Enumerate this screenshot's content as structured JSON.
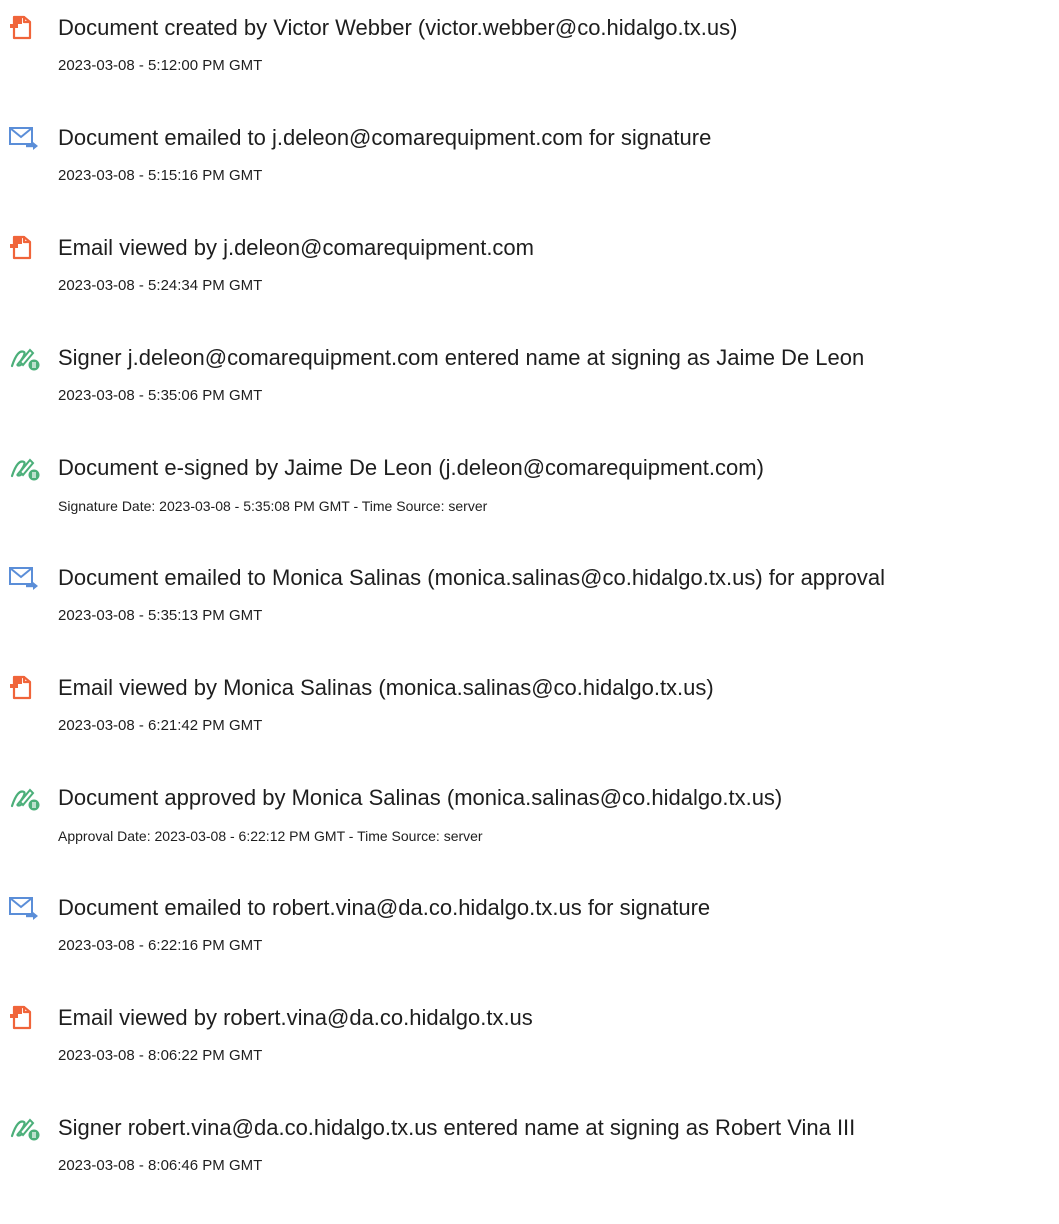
{
  "colors": {
    "doc_icon": "#f0643a",
    "email_icon": "#5b8ed8",
    "sign_icon": "#4caf7a"
  },
  "events": [
    {
      "icon": "document-icon",
      "title": "Document created by Victor Webber (victor.webber@co.hidalgo.tx.us)",
      "meta": "2023-03-08 - 5:12:00 PM GMT"
    },
    {
      "icon": "email-sent-icon",
      "title": "Document emailed to j.deleon@comarequipment.com for signature",
      "meta": "2023-03-08 - 5:15:16 PM GMT"
    },
    {
      "icon": "document-icon",
      "title": "Email viewed by j.deleon@comarequipment.com",
      "meta": "2023-03-08 - 5:24:34 PM GMT"
    },
    {
      "icon": "esign-icon",
      "title": "Signer j.deleon@comarequipment.com entered name at signing as Jaime De Leon",
      "meta": "2023-03-08 - 5:35:06 PM GMT"
    },
    {
      "icon": "esign-icon",
      "title": "Document e-signed by Jaime De Leon (j.deleon@comarequipment.com)",
      "meta": "Signature Date: 2023-03-08 - 5:35:08 PM GMT - Time Source: server"
    },
    {
      "icon": "email-sent-icon",
      "title": "Document emailed to Monica Salinas (monica.salinas@co.hidalgo.tx.us) for approval",
      "meta": "2023-03-08 - 5:35:13 PM GMT"
    },
    {
      "icon": "document-icon",
      "title": "Email viewed by Monica Salinas (monica.salinas@co.hidalgo.tx.us)",
      "meta": "2023-03-08 - 6:21:42 PM GMT"
    },
    {
      "icon": "esign-icon",
      "title": "Document approved by Monica Salinas (monica.salinas@co.hidalgo.tx.us)",
      "meta": "Approval Date: 2023-03-08 - 6:22:12 PM GMT - Time Source: server"
    },
    {
      "icon": "email-sent-icon",
      "title": "Document emailed to robert.vina@da.co.hidalgo.tx.us for signature",
      "meta": "2023-03-08 - 6:22:16 PM GMT"
    },
    {
      "icon": "document-icon",
      "title": "Email viewed by robert.vina@da.co.hidalgo.tx.us",
      "meta": "2023-03-08 - 8:06:22 PM GMT"
    },
    {
      "icon": "esign-icon",
      "title": "Signer robert.vina@da.co.hidalgo.tx.us entered name at signing as Robert Vina III",
      "meta": "2023-03-08 - 8:06:46 PM GMT"
    }
  ]
}
